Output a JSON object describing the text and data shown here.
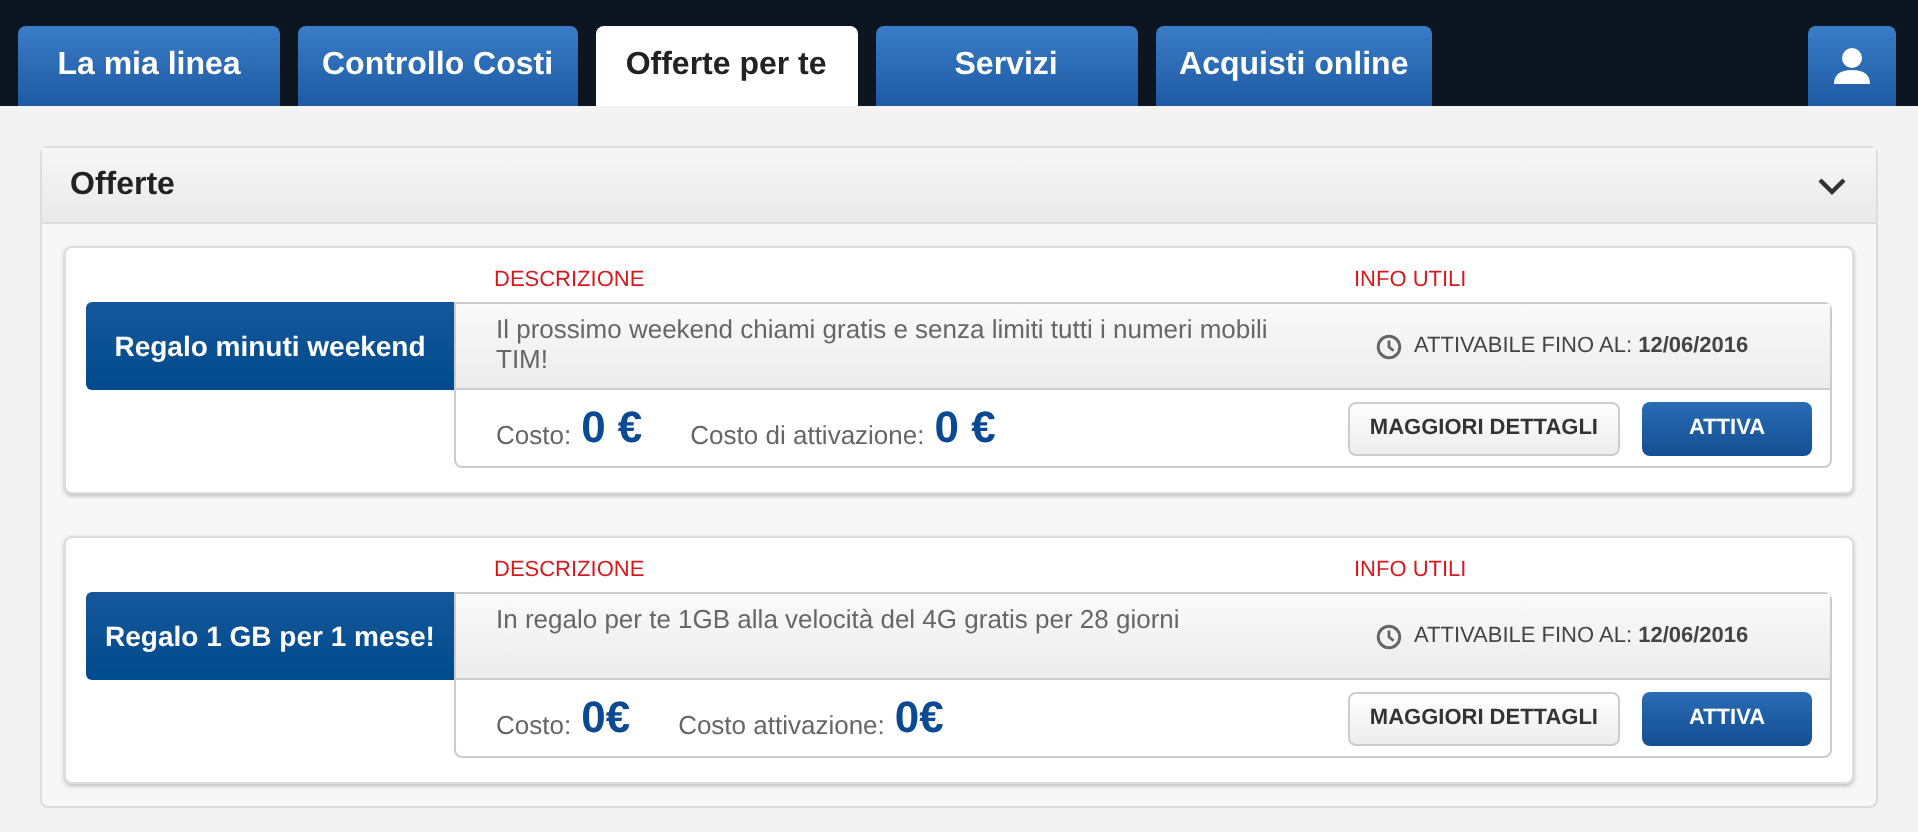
{
  "tabs": [
    {
      "label": "La mia linea",
      "selected": false
    },
    {
      "label": "Controllo Costi",
      "selected": false
    },
    {
      "label": "Offerte per te",
      "selected": true
    },
    {
      "label": "Servizi",
      "selected": false
    },
    {
      "label": "Acquisti online",
      "selected": false
    }
  ],
  "panel": {
    "title": "Offerte",
    "expanded": true
  },
  "offers": [
    {
      "name": "Regalo minuti weekend",
      "description_heading": "DESCRIZIONE",
      "info_heading": "INFO UTILI",
      "description": "Il prossimo weekend chiami gratis e senza limiti tutti i numeri mobili TIM!",
      "info_label": "ATTIVABILE FINO AL:",
      "info_date": "12/06/2016",
      "cost_label": "Costo:",
      "cost_value": "0 €",
      "activation_label": "Costo di attivazione:",
      "activation_value": "0 €",
      "details_button": "MAGGIORI DETTAGLI",
      "activate_button": "ATTIVA"
    },
    {
      "name": "Regalo 1 GB per 1 mese!",
      "description_heading": "DESCRIZIONE",
      "info_heading": "INFO UTILI",
      "description": "In regalo per te 1GB alla velocità del 4G gratis per 28 giorni",
      "info_label": "ATTIVABILE FINO AL:",
      "info_date": "12/06/2016",
      "cost_label": "Costo:",
      "cost_value": "0€",
      "activation_label": "Costo attivazione:",
      "activation_value": "0€",
      "details_button": "MAGGIORI DETTAGLI",
      "activate_button": "ATTIVA"
    }
  ]
}
